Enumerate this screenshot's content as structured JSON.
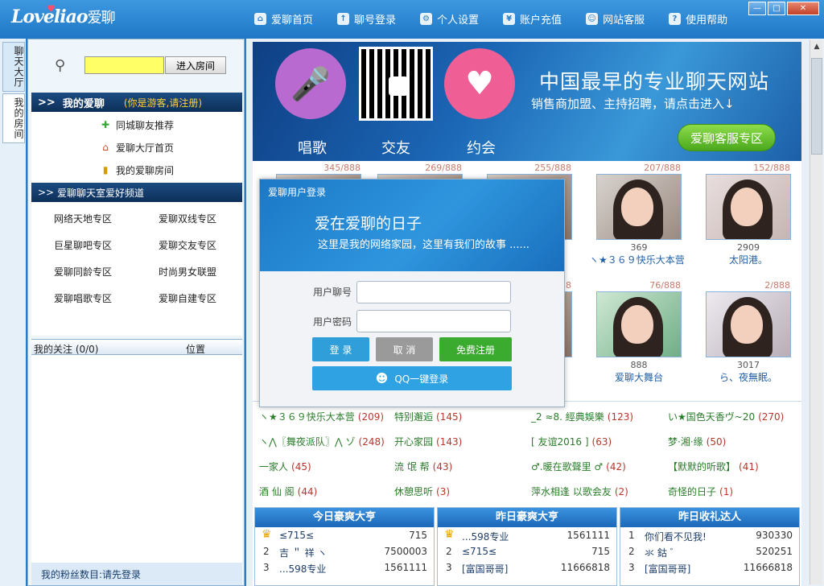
{
  "app": {
    "logo_text": "Loveliao",
    "logo_cn": "爱聊"
  },
  "nav": [
    {
      "label": "爱聊首页",
      "icon": "home-icon",
      "glyph": "⌂"
    },
    {
      "label": "聊号登录",
      "icon": "login-icon",
      "glyph": "↑"
    },
    {
      "label": "个人设置",
      "icon": "gear-icon",
      "glyph": "⚙"
    },
    {
      "label": "账户充值",
      "icon": "wallet-icon",
      "glyph": "¥"
    },
    {
      "label": "网站客服",
      "icon": "support-icon",
      "glyph": "☺"
    },
    {
      "label": "使用帮助",
      "icon": "help-icon",
      "glyph": "?"
    }
  ],
  "side_tabs": [
    "聊天大厅",
    "我的房间"
  ],
  "search": {
    "button_label": "进入房间"
  },
  "my_love": {
    "title": "我的爱聊",
    "guest_note": "(你是游客,请注册)",
    "items": [
      "同城聊友推荐",
      "爱聊大厅首页",
      "我的爱聊房间"
    ]
  },
  "channel": {
    "title": "爱聊聊天室爱好频道",
    "items": [
      "网络天地专区",
      "爱聊双线专区",
      "巨星聊吧专区",
      "爱聊交友专区",
      "爱聊同龄专区",
      "时尚男女联盟",
      "爱聊唱歌专区",
      "爱聊自建专区"
    ]
  },
  "follow": {
    "label": "我的关注 (0/0)",
    "position_label": "位置"
  },
  "fans": {
    "label": "我的粉丝数目:请先登录"
  },
  "banner": {
    "labels": [
      "唱歌",
      "交友",
      "约会"
    ],
    "title": "中国最早的专业聊天网站",
    "subtitle": "销售商加盟、主持招聘，请点击进入↓",
    "service_button": "爱聊客服专区"
  },
  "rooms": [
    {
      "count": "345/888",
      "id": "",
      "name": ""
    },
    {
      "count": "269/888",
      "id": "",
      "name": ""
    },
    {
      "count": "255/888",
      "id": "",
      "name": ""
    },
    {
      "count": "207/888",
      "id": "369",
      "name": "ヽ★３６９快乐大本营"
    },
    {
      "count": "152/888",
      "id": "2909",
      "name": "太阳港。"
    },
    {
      "count": "",
      "id": "",
      "name": ""
    },
    {
      "count": "",
      "id": "",
      "name": ""
    },
    {
      "count": "8",
      "id": "",
      "name": ""
    },
    {
      "count": "76/888",
      "id": "888",
      "name": "爱聊大舞台"
    },
    {
      "count": "2/888",
      "id": "3017",
      "name": "ら、夜無眠。"
    }
  ],
  "room_links": [
    {
      "name": "ヽ★３６９快乐大本营",
      "count": "(209)"
    },
    {
      "name": "特别邂逅",
      "count": "(145)"
    },
    {
      "name": "_2 ≈8. 經典娛樂",
      "count": "(123)"
    },
    {
      "name": "い★国色天香ヴ~20",
      "count": "(270)"
    },
    {
      "name": "ヽ⋀〖舞夜派队〗⋀ ゾ",
      "count": "(248)"
    },
    {
      "name": "开心家园",
      "count": "(143)"
    },
    {
      "name": "[ 友谊2016 ]",
      "count": "(63)"
    },
    {
      "name": "梦·湘·缘",
      "count": "(50)"
    },
    {
      "name": "一家人",
      "count": "(45)"
    },
    {
      "name": "流 氓 帮",
      "count": "(43)"
    },
    {
      "name": "♂.暖在歌聲里 ♂",
      "count": "(42)"
    },
    {
      "name": "【默默的听歌】",
      "count": "(41)"
    },
    {
      "name": "酒 仙 阁",
      "count": "(44)"
    },
    {
      "name": "休憩思听",
      "count": "(3)"
    },
    {
      "name": "萍水相逢 以歌会友",
      "count": "(2)"
    },
    {
      "name": "奇怪的日子",
      "count": "(1)"
    }
  ],
  "rankings": [
    {
      "title": "今日豪爽大亨",
      "rows": [
        {
          "rank": "",
          "name": "≤715≤",
          "value": "715"
        },
        {
          "rank": "2",
          "name": "吉 ＂ 祥 ヽ",
          "value": "7500003"
        },
        {
          "rank": "3",
          "name": "...598专业",
          "value": "1561111"
        }
      ]
    },
    {
      "title": "昨日豪爽大亨",
      "rows": [
        {
          "rank": "",
          "name": "...598专业",
          "value": "1561111"
        },
        {
          "rank": "2",
          "name": "≤715≤",
          "value": "715"
        },
        {
          "rank": "3",
          "name": "[富国哥哥]",
          "value": "11666818"
        }
      ]
    },
    {
      "title": "昨日收礼达人",
      "rows": [
        {
          "rank": "1",
          "name": "你们看不见我!",
          "value": "930330"
        },
        {
          "rank": "2",
          "name": "氺 鈷 ゛",
          "value": "520251"
        },
        {
          "rank": "3",
          "name": "[富国哥哥]",
          "value": "11666818"
        }
      ]
    }
  ],
  "login": {
    "title": "爱聊用户登录",
    "slogan": "爱在爱聊的日子",
    "desc": "这里是我的网络家园，这里有我们的故事 ......",
    "user_label": "用户聊号",
    "pass_label": "用户密码",
    "login_btn": "登 录",
    "cancel_btn": "取 消",
    "register_btn": "免费注册",
    "qq_btn": "QQ一键登录"
  },
  "colors": {
    "accent": "#2a7bc6",
    "dark_head": "#0e2f59",
    "login_green": "#3bab2f",
    "login_blue": "#2f9ed9"
  }
}
